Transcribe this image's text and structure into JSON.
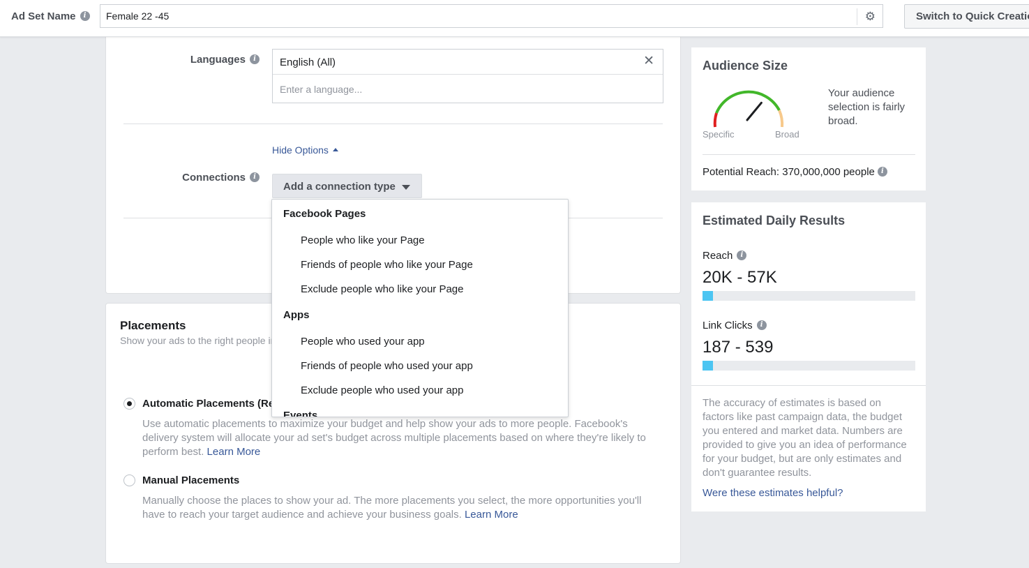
{
  "header": {
    "ad_set_label": "Ad Set Name",
    "ad_set_value": "Female 22 -45",
    "quick_creation_label": "Switch to Quick Creation"
  },
  "audience": {
    "languages_label": "Languages",
    "selected_language": "English (All)",
    "language_placeholder": "Enter a language...",
    "hide_options_label": "Hide Options",
    "connections_label": "Connections",
    "connection_button_label": "Add a connection type"
  },
  "connection_menu": {
    "groups": [
      {
        "heading": "Facebook Pages",
        "items": [
          "People who like your Page",
          "Friends of people who like your Page",
          "Exclude people who like your Page"
        ]
      },
      {
        "heading": "Apps",
        "items": [
          "People who used your app",
          "Friends of people who used your app",
          "Exclude people who used your app"
        ]
      },
      {
        "heading": "Events",
        "items": []
      }
    ]
  },
  "placements": {
    "title": "Placements",
    "subtitle": "Show your ads to the right people in the right places.",
    "automatic": {
      "label": "Automatic Placements (Recommended)",
      "selected": true,
      "description": "Use automatic placements to maximize your budget and help show your ads to more people. Facebook's delivery system will allocate your ad set's budget across multiple placements based on where they're likely to perform best.",
      "learn_more": "Learn More"
    },
    "manual": {
      "label": "Manual Placements",
      "selected": false,
      "description": "Manually choose the places to show your ad. The more placements you select, the more opportunities you'll have to reach your target audience and achieve your business goals.",
      "learn_more": "Learn More"
    }
  },
  "audience_size": {
    "title": "Audience Size",
    "specific_label": "Specific",
    "broad_label": "Broad",
    "gauge_level": 0.72,
    "description": "Your audience selection is fairly broad.",
    "potential_reach_label": "Potential Reach:",
    "potential_reach_value": "370,000,000 people"
  },
  "estimated_results": {
    "title": "Estimated Daily Results",
    "reach": {
      "label": "Reach",
      "value": "20K - 57K",
      "bar_fraction": 0.05
    },
    "link_clicks": {
      "label": "Link Clicks",
      "value": "187 - 539",
      "bar_fraction": 0.05
    },
    "note": "The accuracy of estimates is based on factors like past campaign data, the budget you entered and market data. Numbers are provided to give you an idea of performance for your budget, but are only estimates and don't guarantee results.",
    "helpful_link": "Were these estimates helpful?"
  },
  "colors": {
    "link": "#385898",
    "bar_fill": "#4cc5f2",
    "gauge_green": "#42b72a",
    "gauge_red": "#e02020",
    "gauge_orange": "#f7b928"
  }
}
